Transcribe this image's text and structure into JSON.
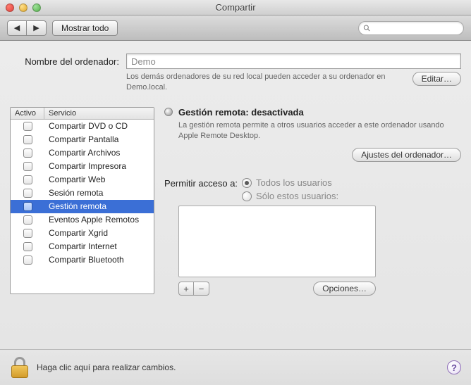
{
  "window": {
    "title": "Compartir"
  },
  "toolbar": {
    "back_glyph": "◀",
    "fwd_glyph": "▶",
    "show_all": "Mostrar todo",
    "search_placeholder": ""
  },
  "computer_name": {
    "label": "Nombre del ordenador:",
    "value": "Demo",
    "hint": "Los demás ordenadores de su red local pueden acceder a su ordenador en Demo.local.",
    "edit_btn": "Editar…"
  },
  "services": {
    "header_active": "Activo",
    "header_service": "Servicio",
    "rows": [
      {
        "label": "Compartir DVD o CD",
        "selected": false
      },
      {
        "label": "Compartir Pantalla",
        "selected": false
      },
      {
        "label": "Compartir Archivos",
        "selected": false
      },
      {
        "label": "Compartir Impresora",
        "selected": false
      },
      {
        "label": "Compartir Web",
        "selected": false
      },
      {
        "label": "Sesión remota",
        "selected": false
      },
      {
        "label": "Gestión remota",
        "selected": true
      },
      {
        "label": "Eventos Apple Remotos",
        "selected": false
      },
      {
        "label": "Compartir Xgrid",
        "selected": false
      },
      {
        "label": "Compartir Internet",
        "selected": false
      },
      {
        "label": "Compartir Bluetooth",
        "selected": false
      }
    ]
  },
  "status": {
    "title": "Gestión remota: desactivada",
    "desc": "La gestión remota permite a otros usuarios acceder a este ordenador usando Apple Remote Desktop.",
    "computer_settings_btn": "Ajustes del ordenador…"
  },
  "access": {
    "label": "Permitir acceso a:",
    "opt_all": "Todos los usuarios",
    "opt_only": "Sólo estos usuarios:",
    "add_glyph": "+",
    "remove_glyph": "−",
    "options_btn": "Opciones…"
  },
  "lockbar": {
    "text": "Haga clic aquí para realizar cambios.",
    "help_glyph": "?"
  }
}
